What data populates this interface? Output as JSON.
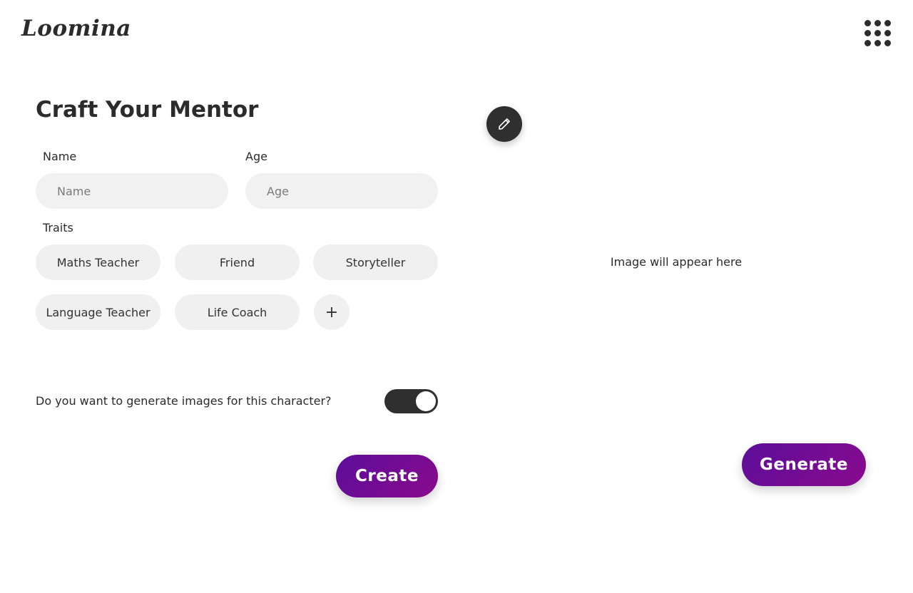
{
  "header": {
    "logo_text": "Loomina",
    "apps_icon": "grid-dots-icon"
  },
  "form": {
    "title": "Craft Your Mentor",
    "name": {
      "label": "Name",
      "placeholder": "Name",
      "value": ""
    },
    "age": {
      "label": "Age",
      "placeholder": "Age",
      "value": ""
    },
    "traits": {
      "label": "Traits",
      "items": [
        "Maths Teacher",
        "Friend",
        "Storyteller",
        "Language Teacher",
        "Life Coach"
      ],
      "add_label": "+"
    },
    "image_question": "Do you want to generate images for this character?",
    "image_toggle_on": true,
    "create_label": "Create"
  },
  "preview": {
    "edit_icon": "pencil-icon",
    "placeholder_text": "Image will appear here",
    "generate_label": "Generate"
  },
  "colors": {
    "primary_gradient_start": "#5b0e9a",
    "primary_gradient_end": "#8a0a8d",
    "dark": "#2f2f2f",
    "input_bg": "#f1f1f1"
  }
}
